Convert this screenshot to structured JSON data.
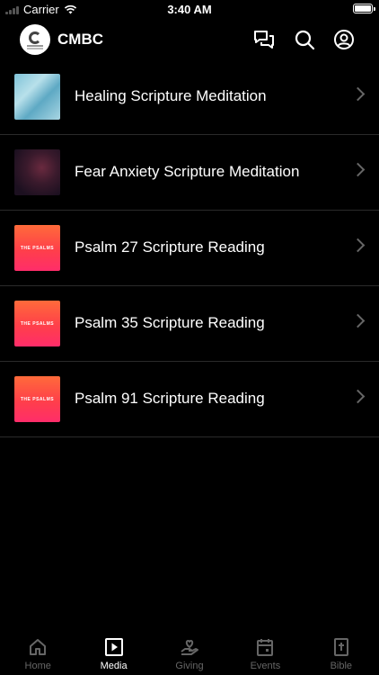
{
  "status_bar": {
    "carrier": "Carrier",
    "time": "3:40 AM"
  },
  "header": {
    "title": "CMBC",
    "icons": [
      "chat-icon",
      "search-icon",
      "profile-icon"
    ]
  },
  "media": {
    "items": [
      {
        "title": "Healing Scripture Meditation",
        "thumb": "sky"
      },
      {
        "title": "Fear Anxiety Scripture Meditation",
        "thumb": "galaxy"
      },
      {
        "title": "Psalm 27 Scripture Reading",
        "thumb": "psalms",
        "thumb_text": "THE PSALMS"
      },
      {
        "title": "Psalm 35 Scripture Reading",
        "thumb": "psalms",
        "thumb_text": "THE PSALMS"
      },
      {
        "title": "Psalm 91 Scripture Reading",
        "thumb": "psalms",
        "thumb_text": "THE PSALMS"
      }
    ]
  },
  "tabs": [
    {
      "label": "Home",
      "icon": "home-icon",
      "active": false
    },
    {
      "label": "Media",
      "icon": "media-icon",
      "active": true
    },
    {
      "label": "Giving",
      "icon": "giving-icon",
      "active": false
    },
    {
      "label": "Events",
      "icon": "calendar-icon",
      "active": false
    },
    {
      "label": "Bible",
      "icon": "bible-icon",
      "active": false
    }
  ]
}
